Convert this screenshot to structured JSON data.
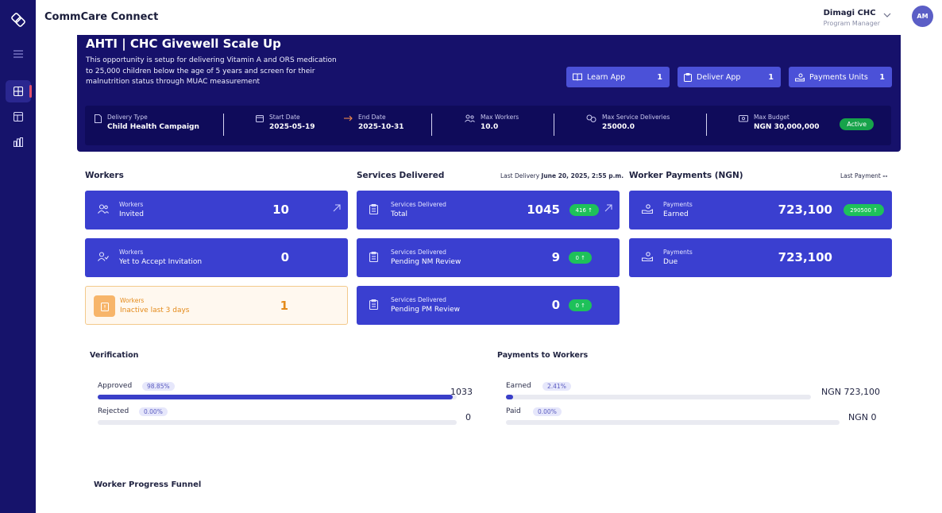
{
  "app": {
    "title": "CommCare Connect"
  },
  "user": {
    "org": "Dimagi CHC",
    "role": "Program Manager",
    "initials": "AM"
  },
  "sidebar": {
    "items": [
      {
        "name": "menu",
        "icon": "hamburger-icon"
      },
      {
        "name": "dashboard",
        "icon": "grid-icon",
        "active": true
      },
      {
        "name": "layout",
        "icon": "table-layout-icon"
      },
      {
        "name": "reports",
        "icon": "bar-report-icon"
      }
    ]
  },
  "opportunity": {
    "title": "AHTI | CHC Givewell Scale Up",
    "description": "This opportunity is setup for delivering Vitamin A and ORS medication to 25,000 children below the age of 5 years and screen for their malnutrition status through MUAC measurement",
    "buttons": [
      {
        "label": "Learn App",
        "count": "1",
        "icon": "book-icon"
      },
      {
        "label": "Deliver App",
        "count": "1",
        "icon": "clipboard-icon"
      },
      {
        "label": "Payments Units",
        "count": "1",
        "icon": "hand-coin-icon"
      }
    ],
    "meta": {
      "delivery_type_label": "Delivery Type",
      "delivery_type": "Child Health Campaign",
      "start_date_label": "Start Date",
      "start_date": "2025-05-19",
      "end_date_label": "End Date",
      "end_date": "2025-10-31",
      "max_workers_label": "Max Workers",
      "max_workers": "10.0",
      "max_service_label": "Max Service Deliveries",
      "max_service": "25000.0",
      "max_budget_label": "Max Budget",
      "max_budget": "NGN 30,000,000",
      "status": "Active"
    }
  },
  "workers": {
    "title": "Workers",
    "cards": [
      {
        "l1": "Workers",
        "l2": "Invited",
        "value": "10"
      },
      {
        "l1": "Workers",
        "l2": "Yet to Accept Invitation",
        "value": "0"
      },
      {
        "l1": "Workers",
        "l2": "Inactive last 3 days",
        "value": "1"
      }
    ]
  },
  "services": {
    "title": "Services Delivered",
    "last_label": "Last Delivery",
    "last_value": "June 20, 2025, 2:55 p.m.",
    "cards": [
      {
        "l1": "Services Delivered",
        "l2": "Total",
        "value": "1045",
        "delta": "416 ↑"
      },
      {
        "l1": "Services Delivered",
        "l2": "Pending NM Review",
        "value": "9",
        "delta": "0 ↑"
      },
      {
        "l1": "Services Delivered",
        "l2": "Pending PM Review",
        "value": "0",
        "delta": "0 ↑"
      }
    ]
  },
  "payments": {
    "title": "Worker Payments (NGN)",
    "last_label": "Last Payment",
    "last_value": "--",
    "cards": [
      {
        "l1": "Payments",
        "l2": "Earned",
        "value": "723,100",
        "delta": "290500 ↑"
      },
      {
        "l1": "Payments",
        "l2": "Due",
        "value": "723,100"
      }
    ]
  },
  "verification": {
    "title": "Verification",
    "rows": [
      {
        "label": "Approved",
        "pct": "98.85%",
        "fraction": 0.9885,
        "value": "1033"
      },
      {
        "label": "Rejected",
        "pct": "0.00%",
        "fraction": 0,
        "value": "0"
      }
    ]
  },
  "payments_to_workers": {
    "title": "Payments to Workers",
    "rows": [
      {
        "label": "Earned",
        "pct": "2.41%",
        "fraction": 0.0241,
        "value": "NGN 723,100"
      },
      {
        "label": "Paid",
        "pct": "0.00%",
        "fraction": 0,
        "value": "NGN 0"
      }
    ]
  },
  "funnel": {
    "title": "Worker Progress Funnel"
  },
  "colors": {
    "sidebar": "#16136b",
    "hero": "#16116b",
    "card": "#3a3fd0",
    "accent_green": "#1ec15a",
    "warn": "#e48a1a"
  }
}
